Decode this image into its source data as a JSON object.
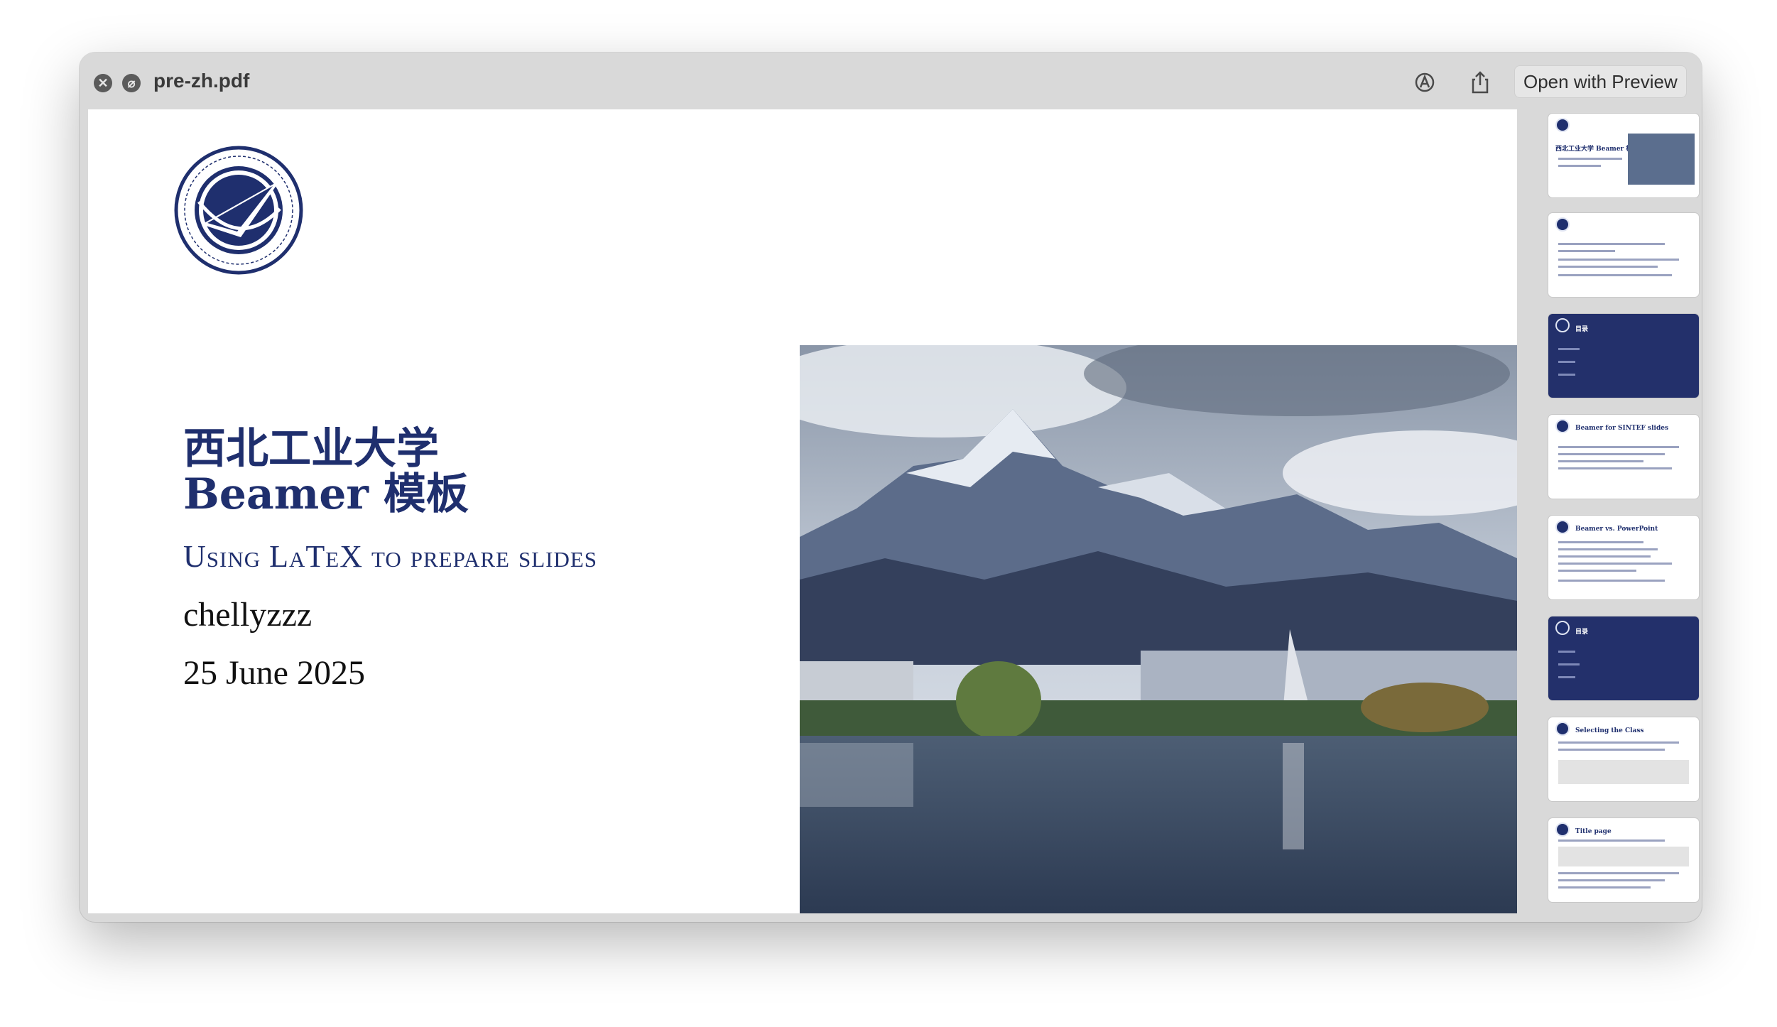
{
  "window": {
    "title": "pre-zh.pdf",
    "open_button": "Open with Preview"
  },
  "icons": {
    "close": "close-icon",
    "markup": "markup-icon",
    "annotate": "annotate-icon",
    "share": "share-icon"
  },
  "slide": {
    "title_line1": "西北工业大学",
    "title_line2": "Beamer 模板",
    "subtitle": "Using LaTeX to prepare slides",
    "author": "chellyzzz",
    "date": "25 June 2025"
  },
  "thumbnails": [
    {
      "heading": "西北工业大学 Beamer 模板",
      "dark": false
    },
    {
      "heading": "",
      "dark": false
    },
    {
      "heading": "目录",
      "dark": true
    },
    {
      "heading": "Beamer for SINTEF slides",
      "dark": false
    },
    {
      "heading": "Beamer vs. PowerPoint",
      "dark": false
    },
    {
      "heading": "目录",
      "dark": true
    },
    {
      "heading": "Selecting the Class",
      "dark": false
    },
    {
      "heading": "Title page",
      "dark": false
    }
  ],
  "colors": {
    "brand": "#1f2f6e",
    "section_slide": "#23306b"
  }
}
